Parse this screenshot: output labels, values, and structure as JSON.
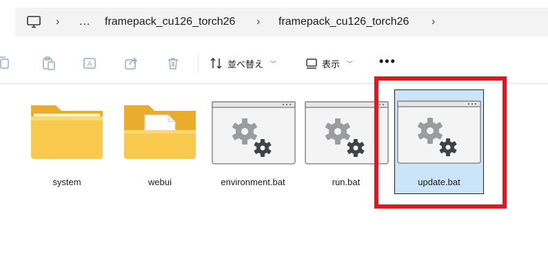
{
  "address_bar": {
    "overflow": "...",
    "crumbs": [
      "framepack_cu126_torch26",
      "framepack_cu126_torch26"
    ]
  },
  "toolbar": {
    "sort_label": "並べ替え",
    "view_label": "表示",
    "more_label": "•••"
  },
  "files": [
    {
      "name": "system",
      "type": "folder"
    },
    {
      "name": "webui",
      "type": "folder-doc"
    },
    {
      "name": "environment.bat",
      "type": "bat"
    },
    {
      "name": "run.bat",
      "type": "bat"
    },
    {
      "name": "update.bat",
      "type": "bat",
      "selected": true
    }
  ],
  "colors": {
    "highlight": "#e8141c",
    "selection": "#cce4f7",
    "folder": "#f6c343"
  }
}
